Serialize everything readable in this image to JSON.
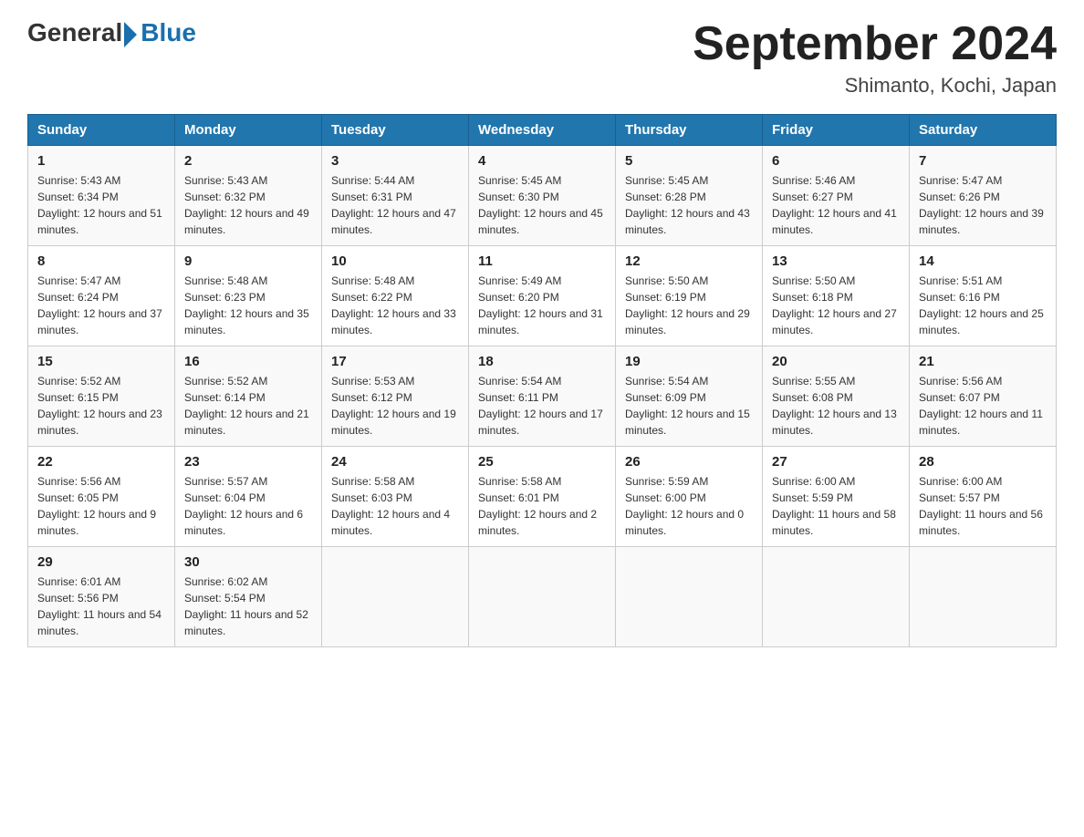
{
  "header": {
    "logo_general": "General",
    "logo_blue": "Blue",
    "title": "September 2024",
    "subtitle": "Shimanto, Kochi, Japan"
  },
  "weekdays": [
    "Sunday",
    "Monday",
    "Tuesday",
    "Wednesday",
    "Thursday",
    "Friday",
    "Saturday"
  ],
  "weeks": [
    [
      {
        "day": "1",
        "sunrise": "5:43 AM",
        "sunset": "6:34 PM",
        "daylight": "12 hours and 51 minutes."
      },
      {
        "day": "2",
        "sunrise": "5:43 AM",
        "sunset": "6:32 PM",
        "daylight": "12 hours and 49 minutes."
      },
      {
        "day": "3",
        "sunrise": "5:44 AM",
        "sunset": "6:31 PM",
        "daylight": "12 hours and 47 minutes."
      },
      {
        "day": "4",
        "sunrise": "5:45 AM",
        "sunset": "6:30 PM",
        "daylight": "12 hours and 45 minutes."
      },
      {
        "day": "5",
        "sunrise": "5:45 AM",
        "sunset": "6:28 PM",
        "daylight": "12 hours and 43 minutes."
      },
      {
        "day": "6",
        "sunrise": "5:46 AM",
        "sunset": "6:27 PM",
        "daylight": "12 hours and 41 minutes."
      },
      {
        "day": "7",
        "sunrise": "5:47 AM",
        "sunset": "6:26 PM",
        "daylight": "12 hours and 39 minutes."
      }
    ],
    [
      {
        "day": "8",
        "sunrise": "5:47 AM",
        "sunset": "6:24 PM",
        "daylight": "12 hours and 37 minutes."
      },
      {
        "day": "9",
        "sunrise": "5:48 AM",
        "sunset": "6:23 PM",
        "daylight": "12 hours and 35 minutes."
      },
      {
        "day": "10",
        "sunrise": "5:48 AM",
        "sunset": "6:22 PM",
        "daylight": "12 hours and 33 minutes."
      },
      {
        "day": "11",
        "sunrise": "5:49 AM",
        "sunset": "6:20 PM",
        "daylight": "12 hours and 31 minutes."
      },
      {
        "day": "12",
        "sunrise": "5:50 AM",
        "sunset": "6:19 PM",
        "daylight": "12 hours and 29 minutes."
      },
      {
        "day": "13",
        "sunrise": "5:50 AM",
        "sunset": "6:18 PM",
        "daylight": "12 hours and 27 minutes."
      },
      {
        "day": "14",
        "sunrise": "5:51 AM",
        "sunset": "6:16 PM",
        "daylight": "12 hours and 25 minutes."
      }
    ],
    [
      {
        "day": "15",
        "sunrise": "5:52 AM",
        "sunset": "6:15 PM",
        "daylight": "12 hours and 23 minutes."
      },
      {
        "day": "16",
        "sunrise": "5:52 AM",
        "sunset": "6:14 PM",
        "daylight": "12 hours and 21 minutes."
      },
      {
        "day": "17",
        "sunrise": "5:53 AM",
        "sunset": "6:12 PM",
        "daylight": "12 hours and 19 minutes."
      },
      {
        "day": "18",
        "sunrise": "5:54 AM",
        "sunset": "6:11 PM",
        "daylight": "12 hours and 17 minutes."
      },
      {
        "day": "19",
        "sunrise": "5:54 AM",
        "sunset": "6:09 PM",
        "daylight": "12 hours and 15 minutes."
      },
      {
        "day": "20",
        "sunrise": "5:55 AM",
        "sunset": "6:08 PM",
        "daylight": "12 hours and 13 minutes."
      },
      {
        "day": "21",
        "sunrise": "5:56 AM",
        "sunset": "6:07 PM",
        "daylight": "12 hours and 11 minutes."
      }
    ],
    [
      {
        "day": "22",
        "sunrise": "5:56 AM",
        "sunset": "6:05 PM",
        "daylight": "12 hours and 9 minutes."
      },
      {
        "day": "23",
        "sunrise": "5:57 AM",
        "sunset": "6:04 PM",
        "daylight": "12 hours and 6 minutes."
      },
      {
        "day": "24",
        "sunrise": "5:58 AM",
        "sunset": "6:03 PM",
        "daylight": "12 hours and 4 minutes."
      },
      {
        "day": "25",
        "sunrise": "5:58 AM",
        "sunset": "6:01 PM",
        "daylight": "12 hours and 2 minutes."
      },
      {
        "day": "26",
        "sunrise": "5:59 AM",
        "sunset": "6:00 PM",
        "daylight": "12 hours and 0 minutes."
      },
      {
        "day": "27",
        "sunrise": "6:00 AM",
        "sunset": "5:59 PM",
        "daylight": "11 hours and 58 minutes."
      },
      {
        "day": "28",
        "sunrise": "6:00 AM",
        "sunset": "5:57 PM",
        "daylight": "11 hours and 56 minutes."
      }
    ],
    [
      {
        "day": "29",
        "sunrise": "6:01 AM",
        "sunset": "5:56 PM",
        "daylight": "11 hours and 54 minutes."
      },
      {
        "day": "30",
        "sunrise": "6:02 AM",
        "sunset": "5:54 PM",
        "daylight": "11 hours and 52 minutes."
      },
      null,
      null,
      null,
      null,
      null
    ]
  ]
}
